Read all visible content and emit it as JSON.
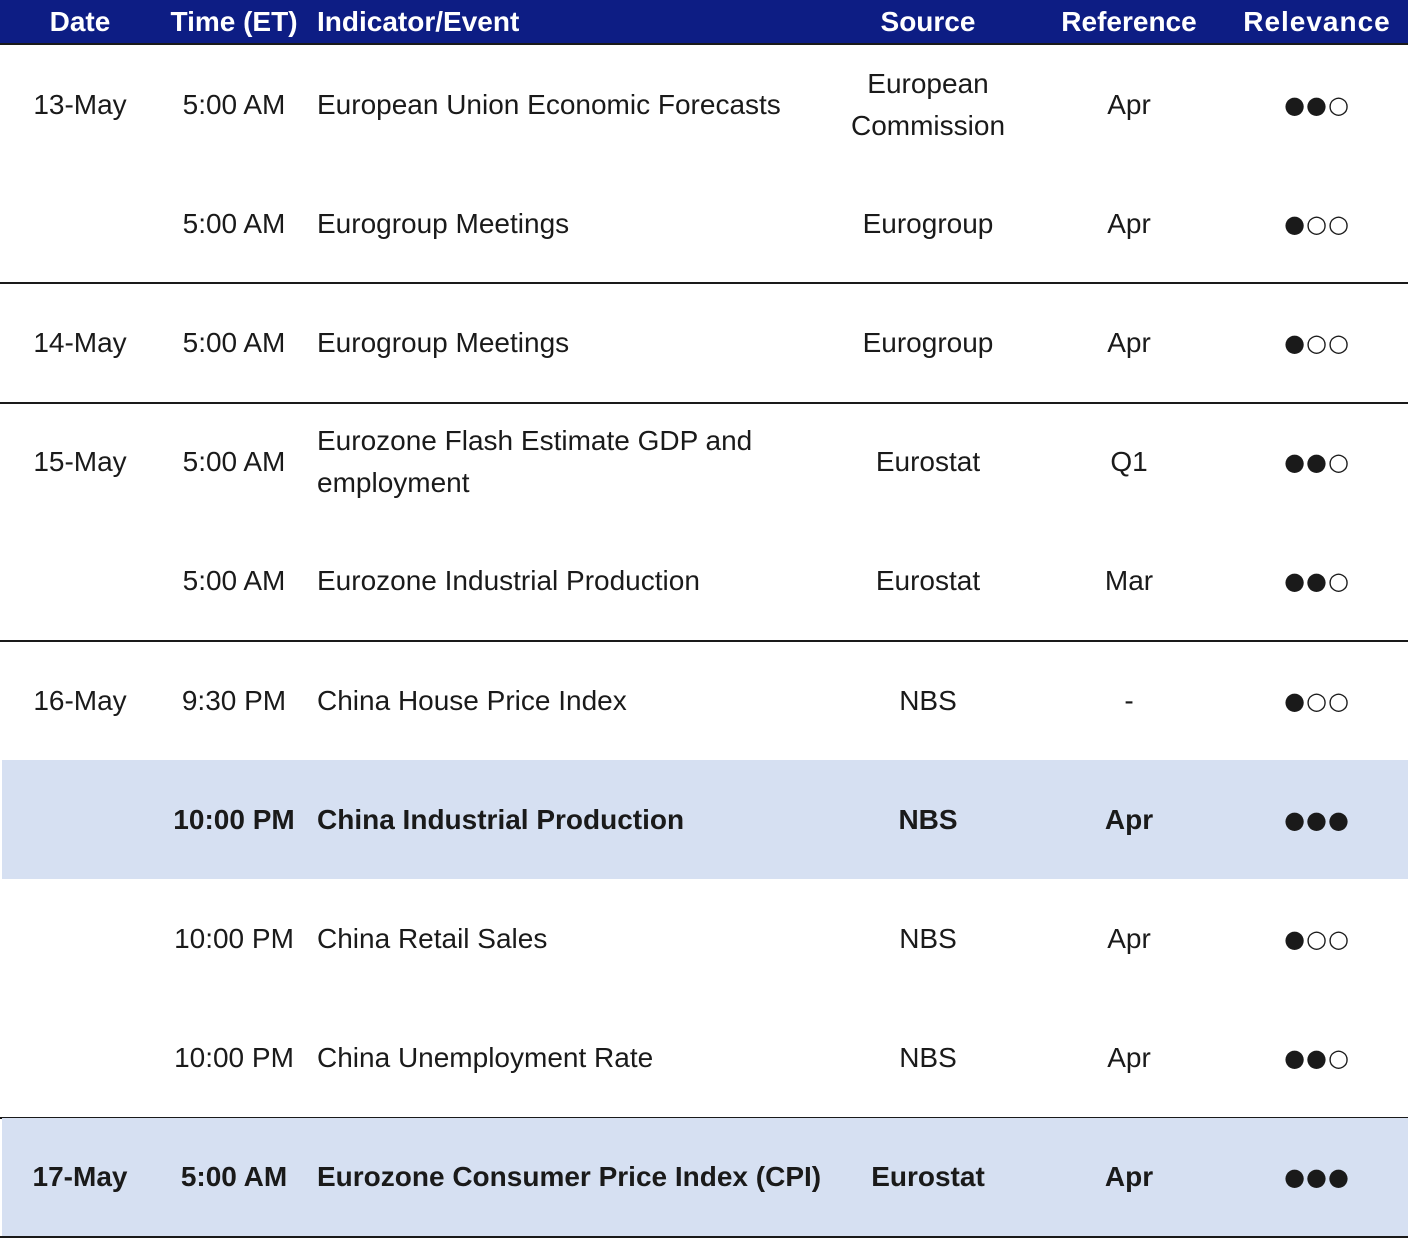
{
  "header": {
    "date": "Date",
    "time": "Time (ET)",
    "event": "Indicator/Event",
    "source": "Source",
    "reference": "Reference",
    "relevance": "Relevance"
  },
  "rows": [
    {
      "date": "13-May",
      "time": "5:00 AM",
      "event": "European Union Economic Forecasts",
      "source": "European Commission",
      "reference": "Apr",
      "relevance": "●●○",
      "bold": false,
      "highlight": false
    },
    {
      "date": "",
      "time": "5:00 AM",
      "event": "Eurogroup Meetings",
      "source": "Eurogroup",
      "reference": "Apr",
      "relevance": "●○○",
      "bold": false,
      "highlight": false
    },
    {
      "date": "14-May",
      "time": "5:00 AM",
      "event": "Eurogroup Meetings",
      "source": "Eurogroup",
      "reference": "Apr",
      "relevance": "●○○",
      "bold": false,
      "highlight": false
    },
    {
      "date": "15-May",
      "time": "5:00 AM",
      "event": "Eurozone Flash Estimate GDP and employment",
      "source": "Eurostat",
      "reference": "Q1",
      "relevance": "●●○",
      "bold": false,
      "highlight": false
    },
    {
      "date": "",
      "time": "5:00 AM",
      "event": "Eurozone Industrial Production",
      "source": "Eurostat",
      "reference": "Mar",
      "relevance": "●●○",
      "bold": false,
      "highlight": false
    },
    {
      "date": "16-May",
      "time": "9:30 PM",
      "event": "China House Price Index",
      "source": "NBS",
      "reference": "-",
      "relevance": "●○○",
      "bold": false,
      "highlight": false
    },
    {
      "date": "",
      "time": "10:00 PM",
      "event": "China Industrial Production",
      "source": "NBS",
      "reference": "Apr",
      "relevance": "●●●",
      "bold": true,
      "highlight": true
    },
    {
      "date": "",
      "time": "10:00 PM",
      "event": "China Retail Sales",
      "source": "NBS",
      "reference": "Apr",
      "relevance": "●○○",
      "bold": false,
      "highlight": false
    },
    {
      "date": "",
      "time": "10:00 PM",
      "event": "China Unemployment Rate",
      "source": "NBS",
      "reference": "Apr",
      "relevance": "●●○",
      "bold": false,
      "highlight": false
    },
    {
      "date": "17-May",
      "time": "5:00 AM",
      "event": "Eurozone Consumer Price Index (CPI)",
      "source": "Eurostat",
      "reference": "Apr",
      "relevance": "●●●",
      "bold": true,
      "highlight": true
    }
  ]
}
